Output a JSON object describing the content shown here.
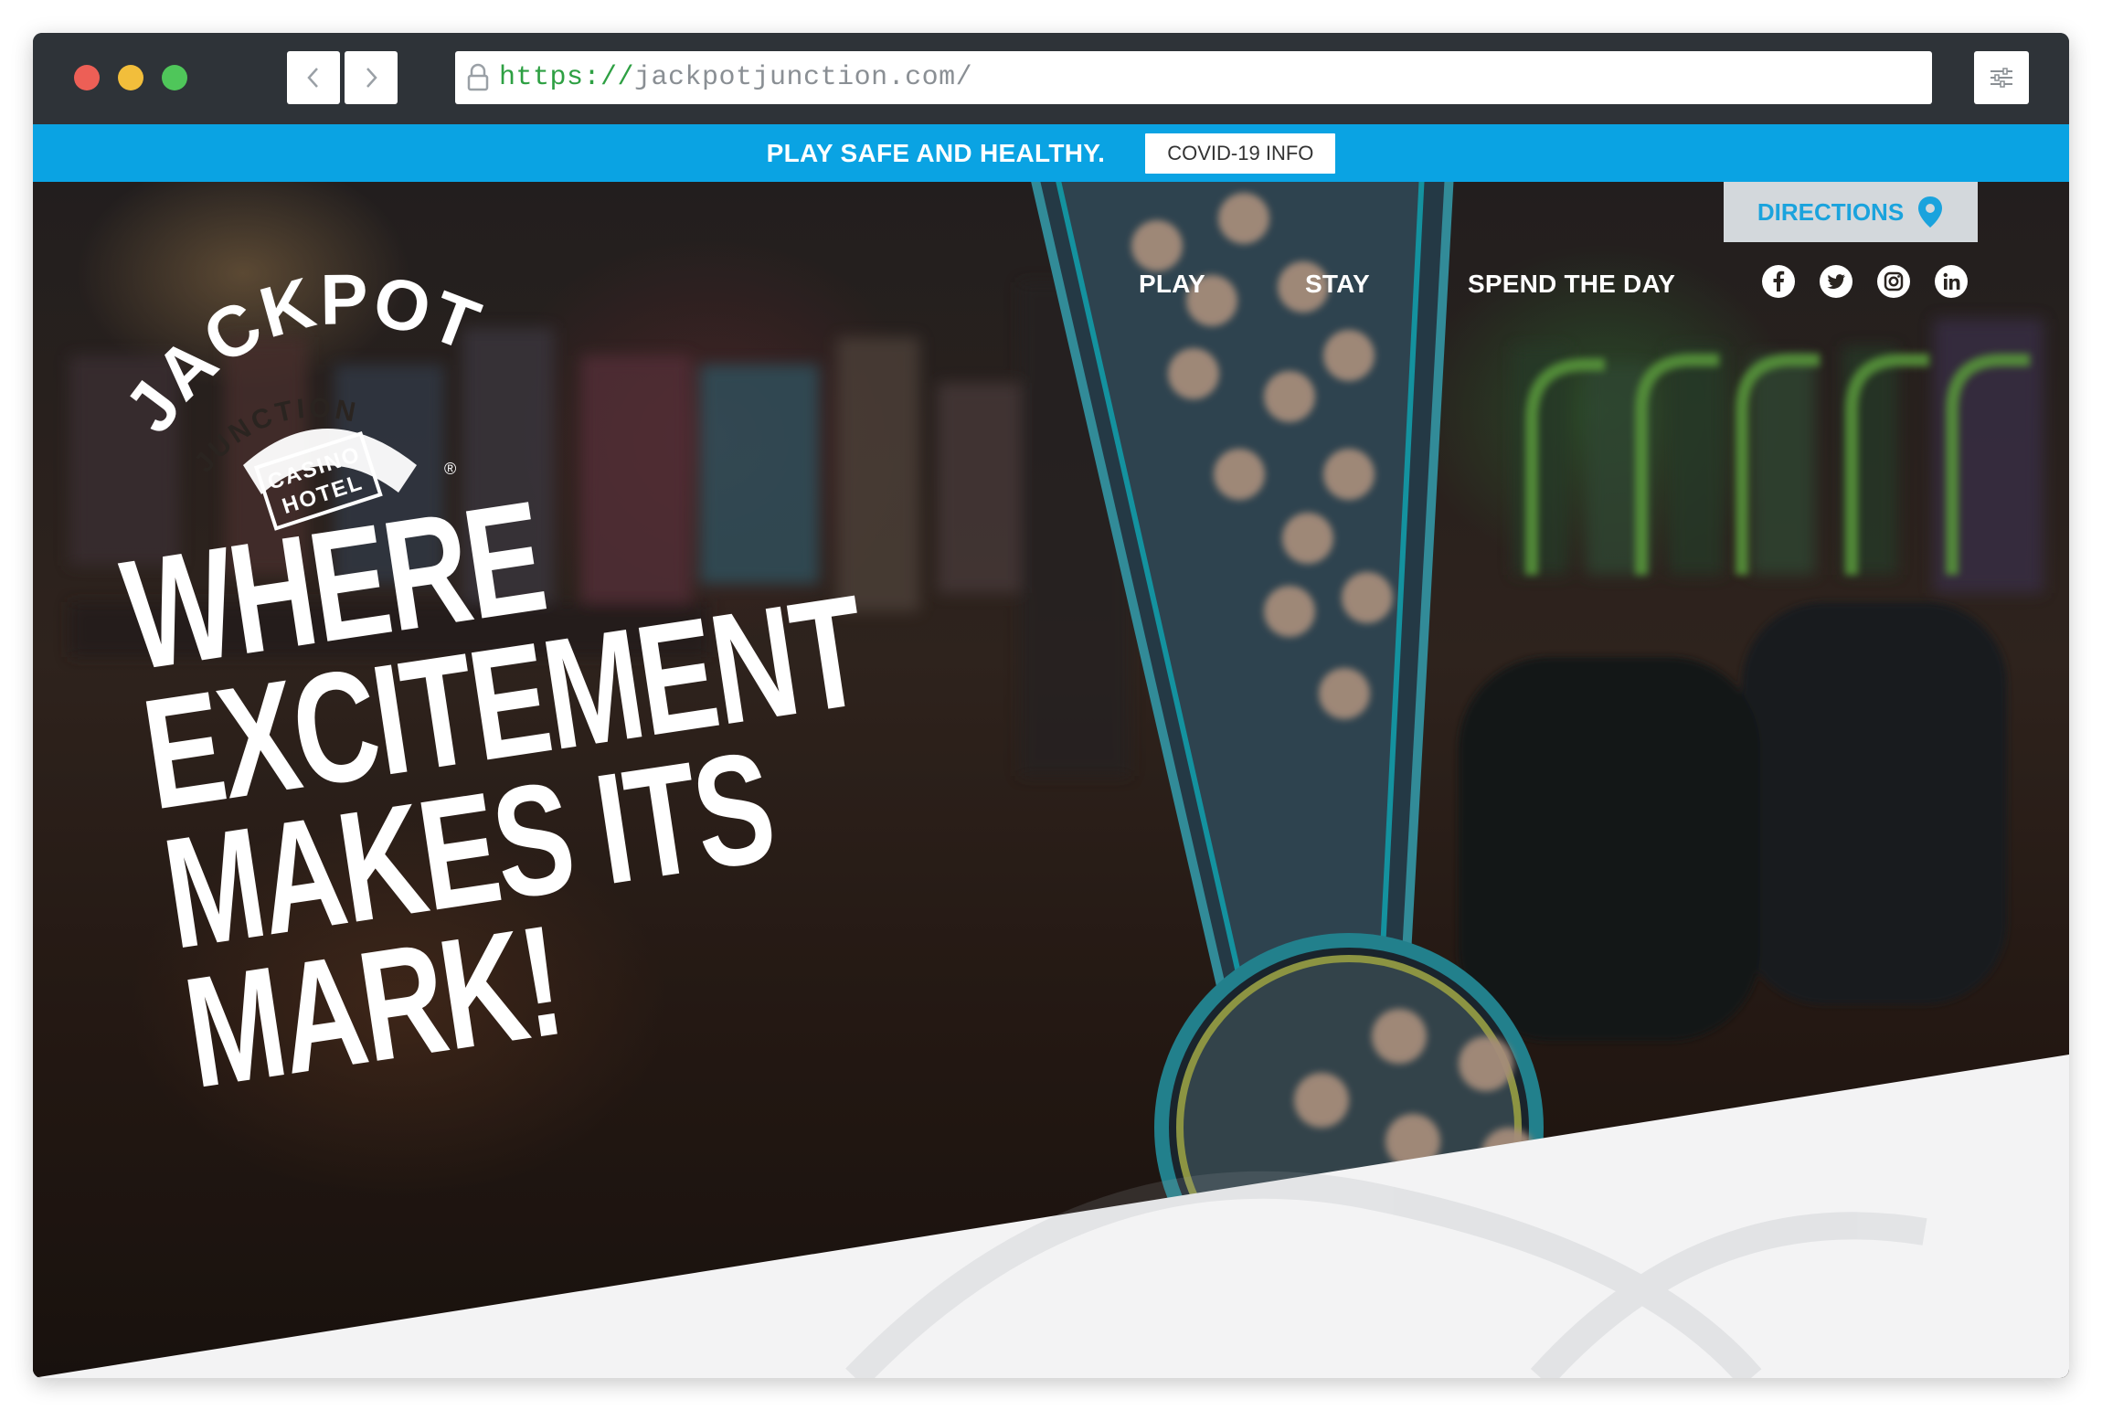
{
  "browser": {
    "url_scheme": "https://",
    "url_rest": "jackpotjunction.com/"
  },
  "alert": {
    "message": "PLAY SAFE AND HEALTHY.",
    "button_label": "COVID-19 INFO"
  },
  "logo": {
    "word1": "JACKPOT!",
    "word2": "JUNCTION",
    "word3": "CASINO",
    "word4": "HOTEL",
    "mark": "®"
  },
  "nav": {
    "items": [
      {
        "label": "PLAY"
      },
      {
        "label": "STAY"
      },
      {
        "label": "SPEND THE DAY"
      }
    ],
    "directions_label": "DIRECTIONS"
  },
  "social": [
    "facebook-icon",
    "twitter-icon",
    "instagram-icon",
    "linkedin-icon"
  ],
  "hero": {
    "headline": [
      "WHERE",
      "EXCITEMENT",
      "MAKES ITS",
      "MARK!"
    ]
  },
  "colors": {
    "accent_blue": "#0aa3e3",
    "directions_bg": "#d3d8dc",
    "neon_green": "#6fc24b"
  }
}
